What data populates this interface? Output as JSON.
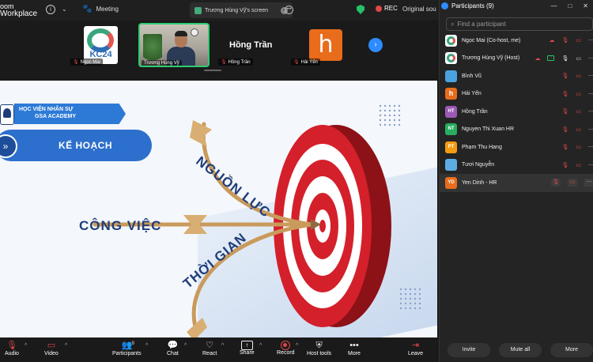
{
  "topbar": {
    "brand_line1": "oom",
    "brand_line2": "Workplace",
    "meeting_label": "Meeting",
    "share_tab_label": "Trương Hùng Vỹ's screen",
    "rec_label": "REC",
    "original_label": "Original sou",
    "shield_color": "#27c06a"
  },
  "strip": {
    "thumbs": [
      {
        "label": "Ngọc Mai",
        "logo_text": "KC24"
      },
      {
        "label": "Trương Hùng Vỹ"
      },
      {
        "label": "Hồng Trần",
        "big_name": "Hồng Trần"
      },
      {
        "label": "Hải Yến",
        "avatar_letter": "h"
      }
    ]
  },
  "slide": {
    "org_line1": "HỌC VIỆN NHÂN SỰ",
    "org_line2": "GSA ACADEMY",
    "plan_title": "KẾ HOẠCH",
    "word_work": "CÔNG VIỆC",
    "word_resources": "NGUỒN LỰC",
    "word_time": "THỜI GIAN",
    "target_red": "#d4202a",
    "arrow_gold": "#c99a5b"
  },
  "toolbar": {
    "audio": "Audio",
    "video": "Video",
    "participants": "Participants",
    "participants_count": "9",
    "chat": "Chat",
    "react": "React",
    "share": "Share",
    "record": "Record",
    "host_tools": "Host tools",
    "more": "More",
    "leave": "Leave"
  },
  "panel": {
    "title": "Participants (9)",
    "search_placeholder": "Find a participant",
    "participants": [
      {
        "name": "Ngọc Mai (Co-host, me)",
        "initials": "",
        "color": "#ffffff"
      },
      {
        "name": "Trương Hùng Vỹ (Host)",
        "initials": "",
        "color": "#ffffff"
      },
      {
        "name": "Bình Vũ",
        "initials": "",
        "color": "#4aa3df"
      },
      {
        "name": "Hải Yến",
        "initials": "h",
        "color": "#e86c1c"
      },
      {
        "name": "Hồng Trần",
        "initials": "HT",
        "color": "#9b59b6"
      },
      {
        "name": "Nguyen Thi Xuan HR",
        "initials": "NT",
        "color": "#27ae60"
      },
      {
        "name": "Phạm Thu Hang",
        "initials": "PT",
        "color": "#f39c12"
      },
      {
        "name": "Tươi Nguyễn",
        "initials": "",
        "color": "#5dade2"
      },
      {
        "name": "Yen Dinh - HR",
        "initials": "YD",
        "color": "#e86c1c"
      }
    ],
    "invite": "Invite",
    "mute_all": "Mute all",
    "more": "More"
  }
}
